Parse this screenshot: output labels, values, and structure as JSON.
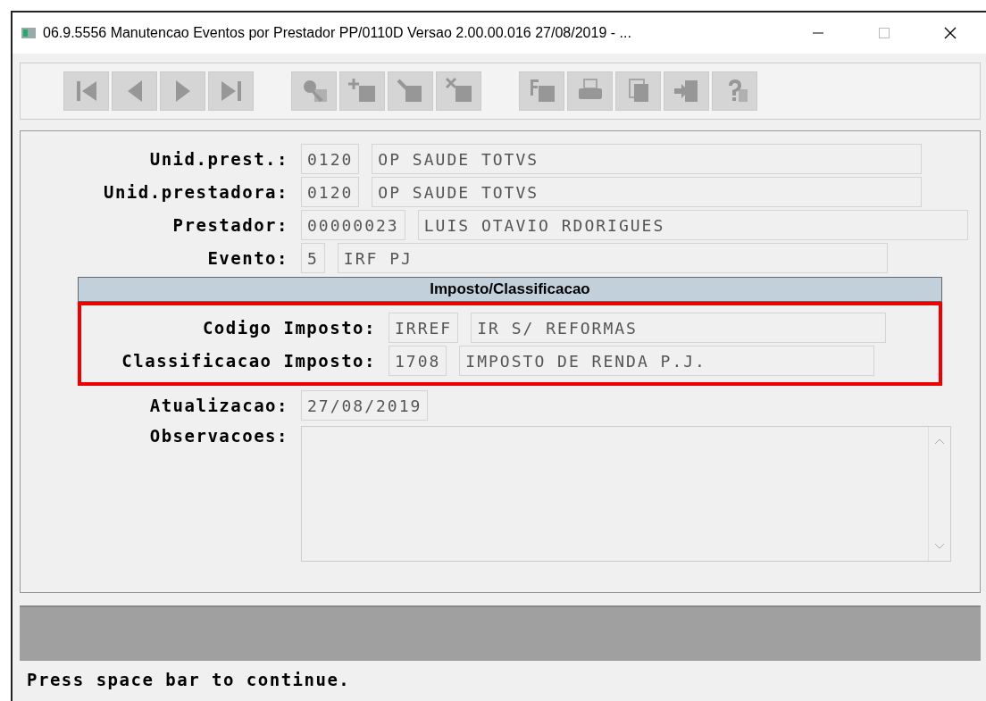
{
  "window": {
    "title": "06.9.5556 Manutencao  Eventos por Prestador  PP/0110D Versao 2.00.00.016 27/08/2019 - ..."
  },
  "toolbar": {
    "groups": [
      [
        {
          "kind": "first",
          "disabled": true
        },
        {
          "kind": "previous",
          "disabled": true
        },
        {
          "kind": "next",
          "disabled": true
        },
        {
          "kind": "last",
          "disabled": true
        }
      ],
      [
        {
          "kind": "search",
          "disabled": true
        },
        {
          "kind": "add",
          "disabled": true
        },
        {
          "kind": "edit",
          "disabled": true
        },
        {
          "kind": "delete",
          "disabled": true
        }
      ],
      [
        {
          "kind": "filter",
          "disabled": true
        },
        {
          "kind": "print",
          "disabled": true
        },
        {
          "kind": "copy",
          "disabled": true
        },
        {
          "kind": "exit",
          "disabled": true
        },
        {
          "kind": "help",
          "disabled": true
        }
      ]
    ]
  },
  "form": {
    "rows": [
      {
        "label": "Unid.prest.:",
        "code": "0120",
        "description": "OP SAUDE TOTVS"
      },
      {
        "label": "Unid.prestadora:",
        "code": "0120",
        "description": "OP SAUDE TOTVS"
      },
      {
        "label": "Prestador:",
        "code": "00000023",
        "description": "LUIS OTAVIO RDORIGUES"
      },
      {
        "label": "Evento:",
        "code": "5",
        "description": "IRF PJ"
      }
    ],
    "update": {
      "label": "Atualizacao:",
      "value": "27/08/2019"
    },
    "notes": {
      "label": "Observacoes:"
    }
  },
  "popup": {
    "title": "Imposto/Classificacao",
    "highlighted": true,
    "rows": [
      {
        "label": "Codigo Imposto:",
        "code": "IRREF",
        "description": "IR S/ REFORMAS"
      },
      {
        "label": "Classificacao Imposto:",
        "code": "1708",
        "description": "IMPOSTO DE RENDA P.J."
      }
    ]
  },
  "status_bar": {
    "message": "Press space bar to continue."
  }
}
